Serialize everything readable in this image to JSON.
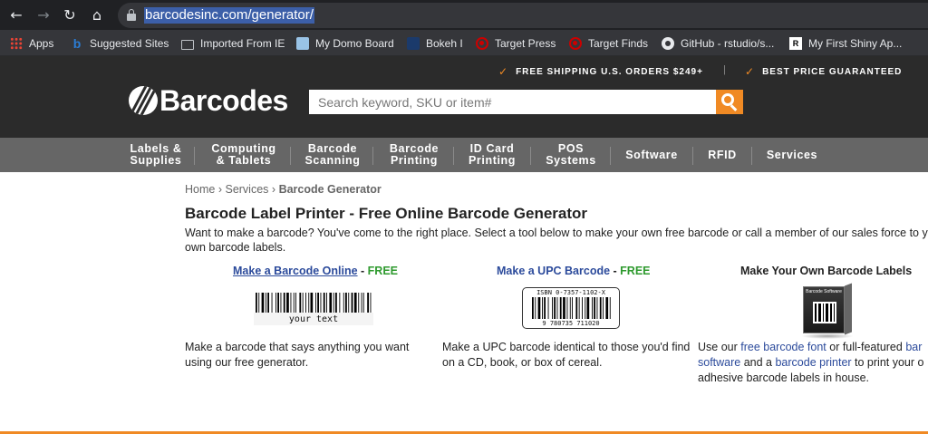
{
  "browser": {
    "url": "barcodesinc.com/generator/",
    "bookmarks": [
      {
        "label": "Apps",
        "icon": "apps-grid-icon"
      },
      {
        "label": "Suggested Sites",
        "icon": "bing-icon"
      },
      {
        "label": "Imported From IE",
        "icon": "folder-icon"
      },
      {
        "label": "My Domo Board",
        "icon": "domo-icon"
      },
      {
        "label": "Bokeh I",
        "icon": "bokeh-icon"
      },
      {
        "label": "Target Press",
        "icon": "target-icon"
      },
      {
        "label": "Target Finds",
        "icon": "target-icon"
      },
      {
        "label": "GitHub - rstudio/s...",
        "icon": "github-icon"
      },
      {
        "label": "My First Shiny Ap...",
        "icon": "shiny-icon"
      }
    ]
  },
  "header": {
    "promo_shipping": "FREE SHIPPING U.S. ORDERS $249+",
    "promo_price": "BEST PRICE GUARANTEED",
    "promo_separator": "|",
    "logo_text": "Barcodes",
    "search_placeholder": "Search keyword, SKU or item#",
    "accent_color": "#f08a24"
  },
  "nav": [
    "Labels &\nSupplies",
    "Computing\n& Tablets",
    "Barcode\nScanning",
    "Barcode\nPrinting",
    "ID Card\nPrinting",
    "POS\nSystems",
    "Software",
    "RFID",
    "Services"
  ],
  "breadcrumb": {
    "home": "Home",
    "sep1": "›",
    "services": "Services",
    "sep2": "›",
    "current": "Barcode Generator"
  },
  "page": {
    "title": "Barcode Label Printer - Free Online Barcode Generator",
    "intro": "Want to make a barcode? You've come to the right place. Select a tool below to make your own free barcode or call a member of our sales force to your own barcode labels."
  },
  "columns": {
    "col1": {
      "link": "Make a Barcode Online",
      "dash": " - ",
      "free": "FREE",
      "sample_text": "your text",
      "text": "Make a barcode that says anything you want using our free generator."
    },
    "col2": {
      "link": "Make a UPC Barcode",
      "dash": " - ",
      "free": "FREE",
      "isbn": "ISBN 0-7357-1102-X",
      "digits": "9 780735 711020",
      "text": "Make a UPC barcode identical to those you'd find on a CD, book, or box of cereal."
    },
    "col3": {
      "heading": "Make Your Own Barcode Labels",
      "box_label": "Barcode Software",
      "text_before": "Use our ",
      "link_font": "free barcode font",
      "text_mid1": " or full-featured ",
      "link_bar": "bar",
      "link_software": "software",
      "text_mid2": " and a ",
      "link_printer": "barcode printer",
      "text_after": " to print your o",
      "text_line3": "adhesive barcode labels in house."
    }
  }
}
